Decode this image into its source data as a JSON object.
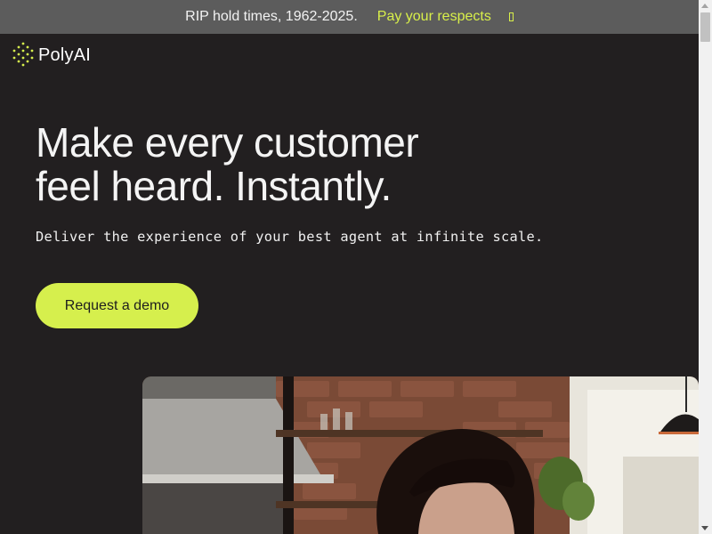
{
  "announcement": {
    "text": "RIP hold times, 1962-2025.",
    "cta_label": "Pay your respects"
  },
  "brand": {
    "name": "PolyAI",
    "accent_color": "#d6ef4d",
    "background_color": "#221f20"
  },
  "hero": {
    "title_line1": "Make every customer",
    "title_line2": "feel heard. Instantly.",
    "subtitle": "Deliver the experience of your best agent at infinite scale.",
    "cta_label": "Request a demo",
    "image_description_icon": "woman-in-kitchen-photo"
  },
  "icons": {
    "logo": "polyai-dots-logo-icon",
    "announcement_arrow": "arrow-right-icon"
  }
}
